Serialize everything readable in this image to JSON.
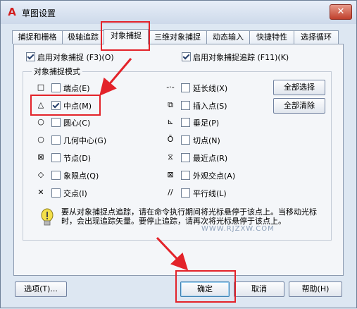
{
  "window": {
    "title": "草图设置",
    "close_label": "✕"
  },
  "tabs": [
    {
      "label": "捕捉和栅格"
    },
    {
      "label": "极轴追踪"
    },
    {
      "label": "对象捕捉"
    },
    {
      "label": "三维对象捕捉"
    },
    {
      "label": "动态输入"
    },
    {
      "label": "快捷特性"
    },
    {
      "label": "选择循环"
    }
  ],
  "top": {
    "snap_on": {
      "label": "启用对象捕捉 (F3)(O)",
      "checked": true
    },
    "tracking_on": {
      "label": "启用对象捕捉追踪 (F11)(K)",
      "checked": true
    }
  },
  "group": {
    "title": "对象捕捉模式"
  },
  "modes_left": [
    {
      "symbol": "□",
      "label": "端点(E)",
      "checked": false
    },
    {
      "symbol": "△",
      "label": "中点(M)",
      "checked": true
    },
    {
      "symbol": "○",
      "label": "圆心(C)",
      "checked": false
    },
    {
      "symbol": "○",
      "label": "几何中心(G)",
      "checked": false
    },
    {
      "symbol": "⊠",
      "label": "节点(D)",
      "checked": false
    },
    {
      "symbol": "◇",
      "label": "象限点(Q)",
      "checked": false
    },
    {
      "symbol": "✕",
      "label": "交点(I)",
      "checked": false
    }
  ],
  "modes_right": [
    {
      "symbol": "-·-",
      "label": "延长线(X)",
      "checked": false
    },
    {
      "symbol": "⧉",
      "label": "插入点(S)",
      "checked": false
    },
    {
      "symbol": "⊾",
      "label": "垂足(P)",
      "checked": false
    },
    {
      "symbol": "Ō",
      "label": "切点(N)",
      "checked": false
    },
    {
      "symbol": "⧖",
      "label": "最近点(R)",
      "checked": false
    },
    {
      "symbol": "⊠",
      "label": "外观交点(A)",
      "checked": false
    },
    {
      "symbol": "//",
      "label": "平行线(L)",
      "checked": false
    }
  ],
  "buttons": {
    "select_all": "全部选择",
    "clear_all": "全部清除"
  },
  "hint": "要从对象捕捉点追踪，请在命令执行期间将光标悬停于该点上。当移动光标时，会出现追踪矢量。要停止追踪，请再次将光标悬停于该点上。",
  "watermark": "WWW.RJZXW.COM",
  "footer": {
    "options": "选项(T)...",
    "ok": "确定",
    "cancel": "取消",
    "help": "帮助(H)"
  }
}
